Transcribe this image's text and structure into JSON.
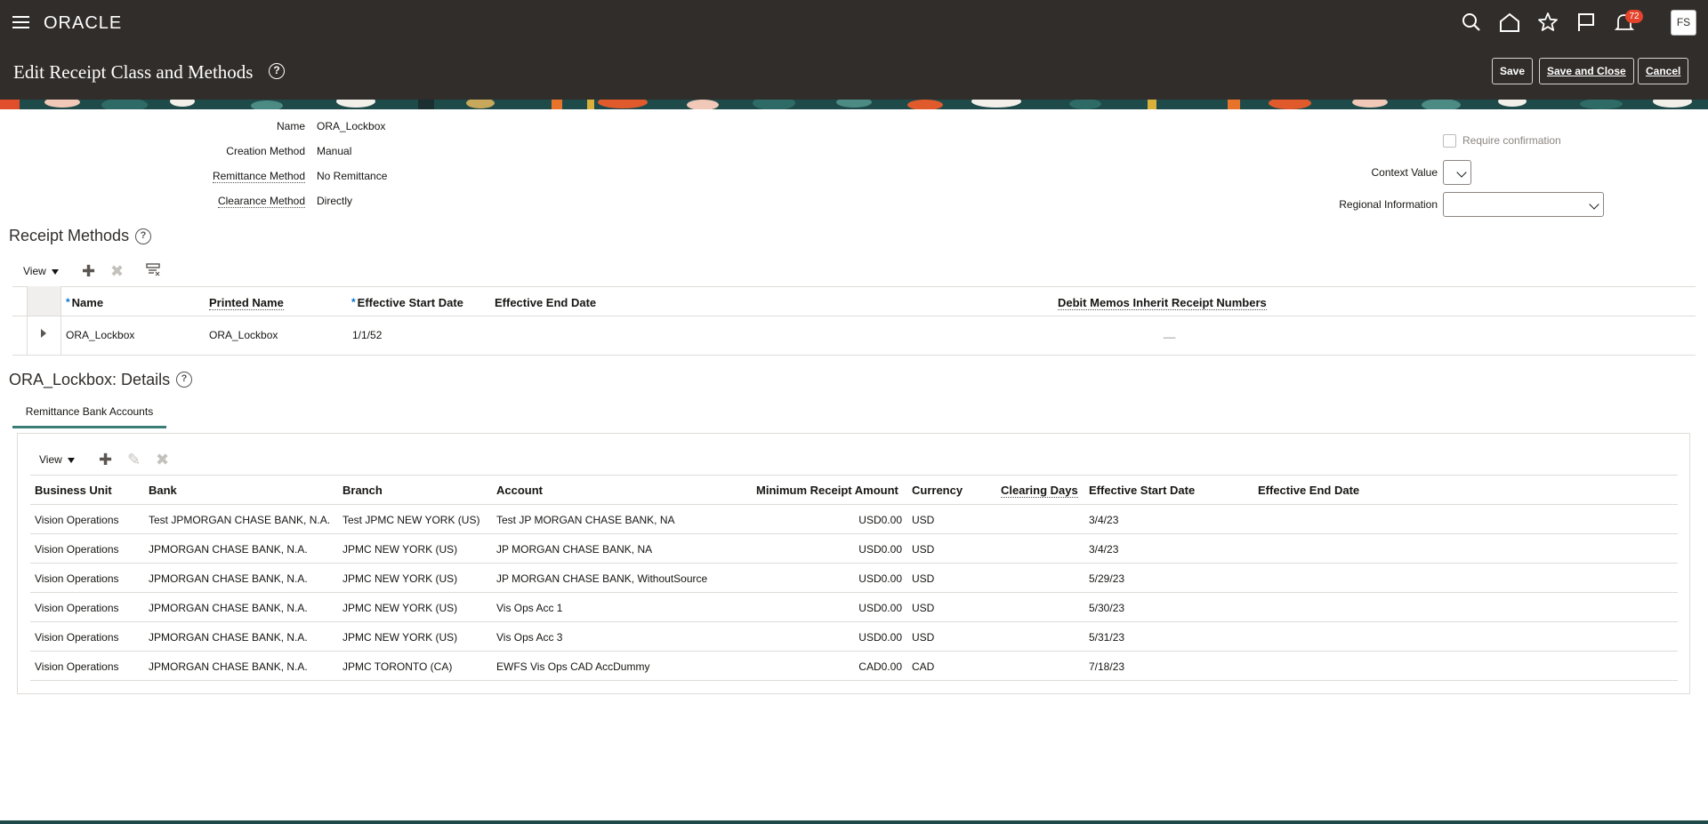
{
  "header": {
    "logo": "ORACLE",
    "notifications_count": "72",
    "avatar_initials": "FS",
    "icons": [
      "menu-icon",
      "search-icon",
      "home-icon",
      "favorites-star-icon",
      "flag-icon",
      "bell-icon"
    ]
  },
  "page": {
    "title": "Edit Receipt Class and Methods",
    "save_label": "Save",
    "save_close_label": "Save and Close",
    "cancel_label": "Cancel"
  },
  "form": {
    "name_label": "Name",
    "name_value": "ORA_Lockbox",
    "creation_label": "Creation Method",
    "creation_value": "Manual",
    "remittance_label": "Remittance Method",
    "remittance_value": "No Remittance",
    "clearance_label": "Clearance Method",
    "clearance_value": "Directly",
    "require_confirmation_label": "Require confirmation",
    "require_confirmation_checked": false,
    "context_value_label": "Context Value",
    "context_value": "",
    "regional_info_label": "Regional Information",
    "regional_info_value": ""
  },
  "receipt_methods": {
    "title": "Receipt Methods",
    "view_label": "View",
    "columns": {
      "name": "Name",
      "printed_name": "Printed Name",
      "start_date": "Effective Start Date",
      "end_date": "Effective End Date",
      "debit_memos": "Debit Memos Inherit Receipt Numbers"
    },
    "rows": [
      {
        "name": "ORA_Lockbox",
        "printed_name": "ORA_Lockbox",
        "start_date": "1/1/52",
        "end_date": "",
        "debit_memos": "__"
      }
    ]
  },
  "details": {
    "title": "ORA_Lockbox: Details",
    "tab_label": "Remittance Bank Accounts",
    "view_label": "View",
    "columns": {
      "business_unit": "Business Unit",
      "bank": "Bank",
      "branch": "Branch",
      "account": "Account",
      "min_amount": "Minimum Receipt Amount",
      "currency": "Currency",
      "clearing_days": "Clearing Days",
      "start_date": "Effective Start Date",
      "end_date": "Effective End Date"
    },
    "rows": [
      {
        "business_unit": "Vision Operations",
        "bank": "Test JPMORGAN CHASE BANK, N.A.",
        "branch": "Test JPMC NEW YORK (US)",
        "account": "Test JP MORGAN CHASE BANK, NA",
        "min_amount": "USD0.00",
        "currency": "USD",
        "clearing_days": "",
        "start_date": "3/4/23",
        "end_date": ""
      },
      {
        "business_unit": "Vision Operations",
        "bank": "JPMORGAN CHASE BANK, N.A.",
        "branch": "JPMC NEW YORK (US)",
        "account": "JP MORGAN CHASE BANK, NA",
        "min_amount": "USD0.00",
        "currency": "USD",
        "clearing_days": "",
        "start_date": "3/4/23",
        "end_date": ""
      },
      {
        "business_unit": "Vision Operations",
        "bank": "JPMORGAN CHASE BANK, N.A.",
        "branch": "JPMC NEW YORK (US)",
        "account": "JP MORGAN CHASE BANK, WithoutSource",
        "min_amount": "USD0.00",
        "currency": "USD",
        "clearing_days": "",
        "start_date": "5/29/23",
        "end_date": ""
      },
      {
        "business_unit": "Vision Operations",
        "bank": "JPMORGAN CHASE BANK, N.A.",
        "branch": "JPMC NEW YORK (US)",
        "account": "Vis Ops Acc 1",
        "min_amount": "USD0.00",
        "currency": "USD",
        "clearing_days": "",
        "start_date": "5/30/23",
        "end_date": ""
      },
      {
        "business_unit": "Vision Operations",
        "bank": "JPMORGAN CHASE BANK, N.A.",
        "branch": "JPMC NEW YORK (US)",
        "account": "Vis Ops Acc 3",
        "min_amount": "USD0.00",
        "currency": "USD",
        "clearing_days": "",
        "start_date": "5/31/23",
        "end_date": ""
      },
      {
        "business_unit": "Vision Operations",
        "bank": "JPMORGAN CHASE BANK, N.A.",
        "branch": "JPMC TORONTO (CA)",
        "account": "EWFS Vis Ops CAD AccDummy",
        "min_amount": "CAD0.00",
        "currency": "CAD",
        "clearing_days": "",
        "start_date": "7/18/23",
        "end_date": ""
      }
    ]
  },
  "colors": {
    "header_bg": "#312d2a",
    "accent_teal": "#3a7d74",
    "badge_red": "#e5432b",
    "required_blue": "#0572ce"
  }
}
